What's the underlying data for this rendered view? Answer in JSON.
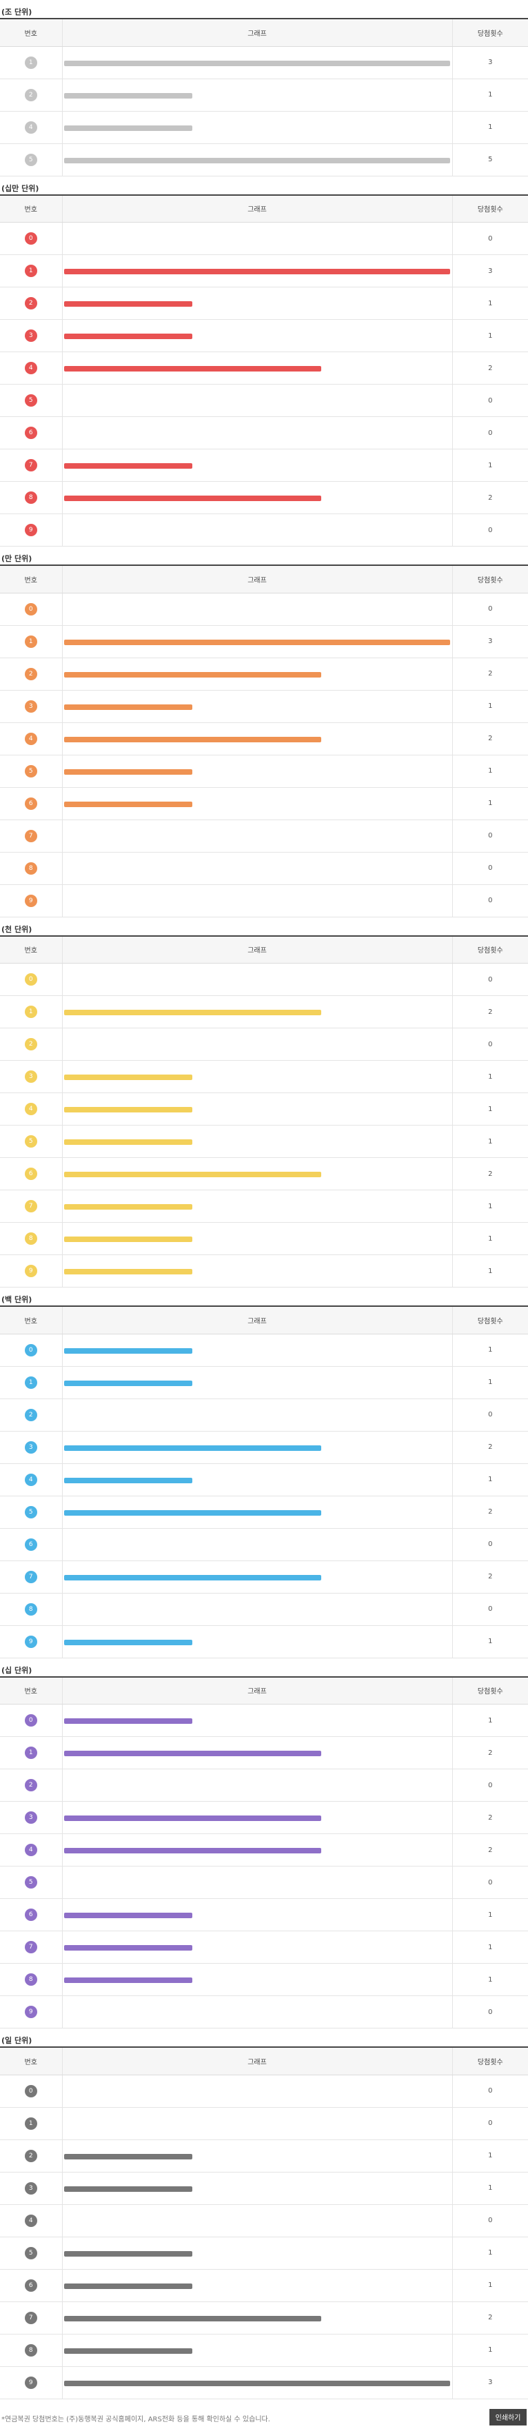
{
  "headers": {
    "number": "번호",
    "graph": "그래프",
    "count": "당첨횟수"
  },
  "max_count": 3,
  "sections": [
    {
      "title": "(조 단위)",
      "color": "#c4c4c4",
      "rows": [
        {
          "num": "1",
          "count": 3
        },
        {
          "num": "2",
          "count": 1
        },
        {
          "num": "4",
          "count": 1
        },
        {
          "num": "5",
          "count": 5
        }
      ]
    },
    {
      "title": "(십만 단위)",
      "color": "#e85252",
      "rows": [
        {
          "num": "0",
          "count": 0
        },
        {
          "num": "1",
          "count": 3
        },
        {
          "num": "2",
          "count": 1
        },
        {
          "num": "3",
          "count": 1
        },
        {
          "num": "4",
          "count": 2
        },
        {
          "num": "5",
          "count": 0
        },
        {
          "num": "6",
          "count": 0
        },
        {
          "num": "7",
          "count": 1
        },
        {
          "num": "8",
          "count": 2
        },
        {
          "num": "9",
          "count": 0
        }
      ]
    },
    {
      "title": "(만 단위)",
      "color": "#ef9252",
      "rows": [
        {
          "num": "0",
          "count": 0
        },
        {
          "num": "1",
          "count": 3
        },
        {
          "num": "2",
          "count": 2
        },
        {
          "num": "3",
          "count": 1
        },
        {
          "num": "4",
          "count": 2
        },
        {
          "num": "5",
          "count": 1
        },
        {
          "num": "6",
          "count": 1
        },
        {
          "num": "7",
          "count": 0
        },
        {
          "num": "8",
          "count": 0
        },
        {
          "num": "9",
          "count": 0
        }
      ]
    },
    {
      "title": "(천 단위)",
      "color": "#f3d05a",
      "rows": [
        {
          "num": "0",
          "count": 0
        },
        {
          "num": "1",
          "count": 2
        },
        {
          "num": "2",
          "count": 0
        },
        {
          "num": "3",
          "count": 1
        },
        {
          "num": "4",
          "count": 1
        },
        {
          "num": "5",
          "count": 1
        },
        {
          "num": "6",
          "count": 2
        },
        {
          "num": "7",
          "count": 1
        },
        {
          "num": "8",
          "count": 1
        },
        {
          "num": "9",
          "count": 1
        }
      ]
    },
    {
      "title": "(백 단위)",
      "color": "#4ab4e6",
      "rows": [
        {
          "num": "0",
          "count": 1
        },
        {
          "num": "1",
          "count": 1
        },
        {
          "num": "2",
          "count": 0
        },
        {
          "num": "3",
          "count": 2
        },
        {
          "num": "4",
          "count": 1
        },
        {
          "num": "5",
          "count": 2
        },
        {
          "num": "6",
          "count": 0
        },
        {
          "num": "7",
          "count": 2
        },
        {
          "num": "8",
          "count": 0
        },
        {
          "num": "9",
          "count": 1
        }
      ]
    },
    {
      "title": "(십 단위)",
      "color": "#8e6fc8",
      "rows": [
        {
          "num": "0",
          "count": 1
        },
        {
          "num": "1",
          "count": 2
        },
        {
          "num": "2",
          "count": 0
        },
        {
          "num": "3",
          "count": 2
        },
        {
          "num": "4",
          "count": 2
        },
        {
          "num": "5",
          "count": 0
        },
        {
          "num": "6",
          "count": 1
        },
        {
          "num": "7",
          "count": 1
        },
        {
          "num": "8",
          "count": 1
        },
        {
          "num": "9",
          "count": 0
        }
      ]
    },
    {
      "title": "(일 단위)",
      "color": "#777777",
      "rows": [
        {
          "num": "0",
          "count": 0
        },
        {
          "num": "1",
          "count": 0
        },
        {
          "num": "2",
          "count": 1
        },
        {
          "num": "3",
          "count": 1
        },
        {
          "num": "4",
          "count": 0
        },
        {
          "num": "5",
          "count": 1
        },
        {
          "num": "6",
          "count": 1
        },
        {
          "num": "7",
          "count": 2
        },
        {
          "num": "8",
          "count": 1
        },
        {
          "num": "9",
          "count": 3
        }
      ]
    }
  ],
  "footer": {
    "note": "*연금복권 당첨번호는 (주)동행복권 공식홈페이지, ARS전화 등을 통해 확인하실 수 있습니다.",
    "print_label": "인쇄하기"
  }
}
